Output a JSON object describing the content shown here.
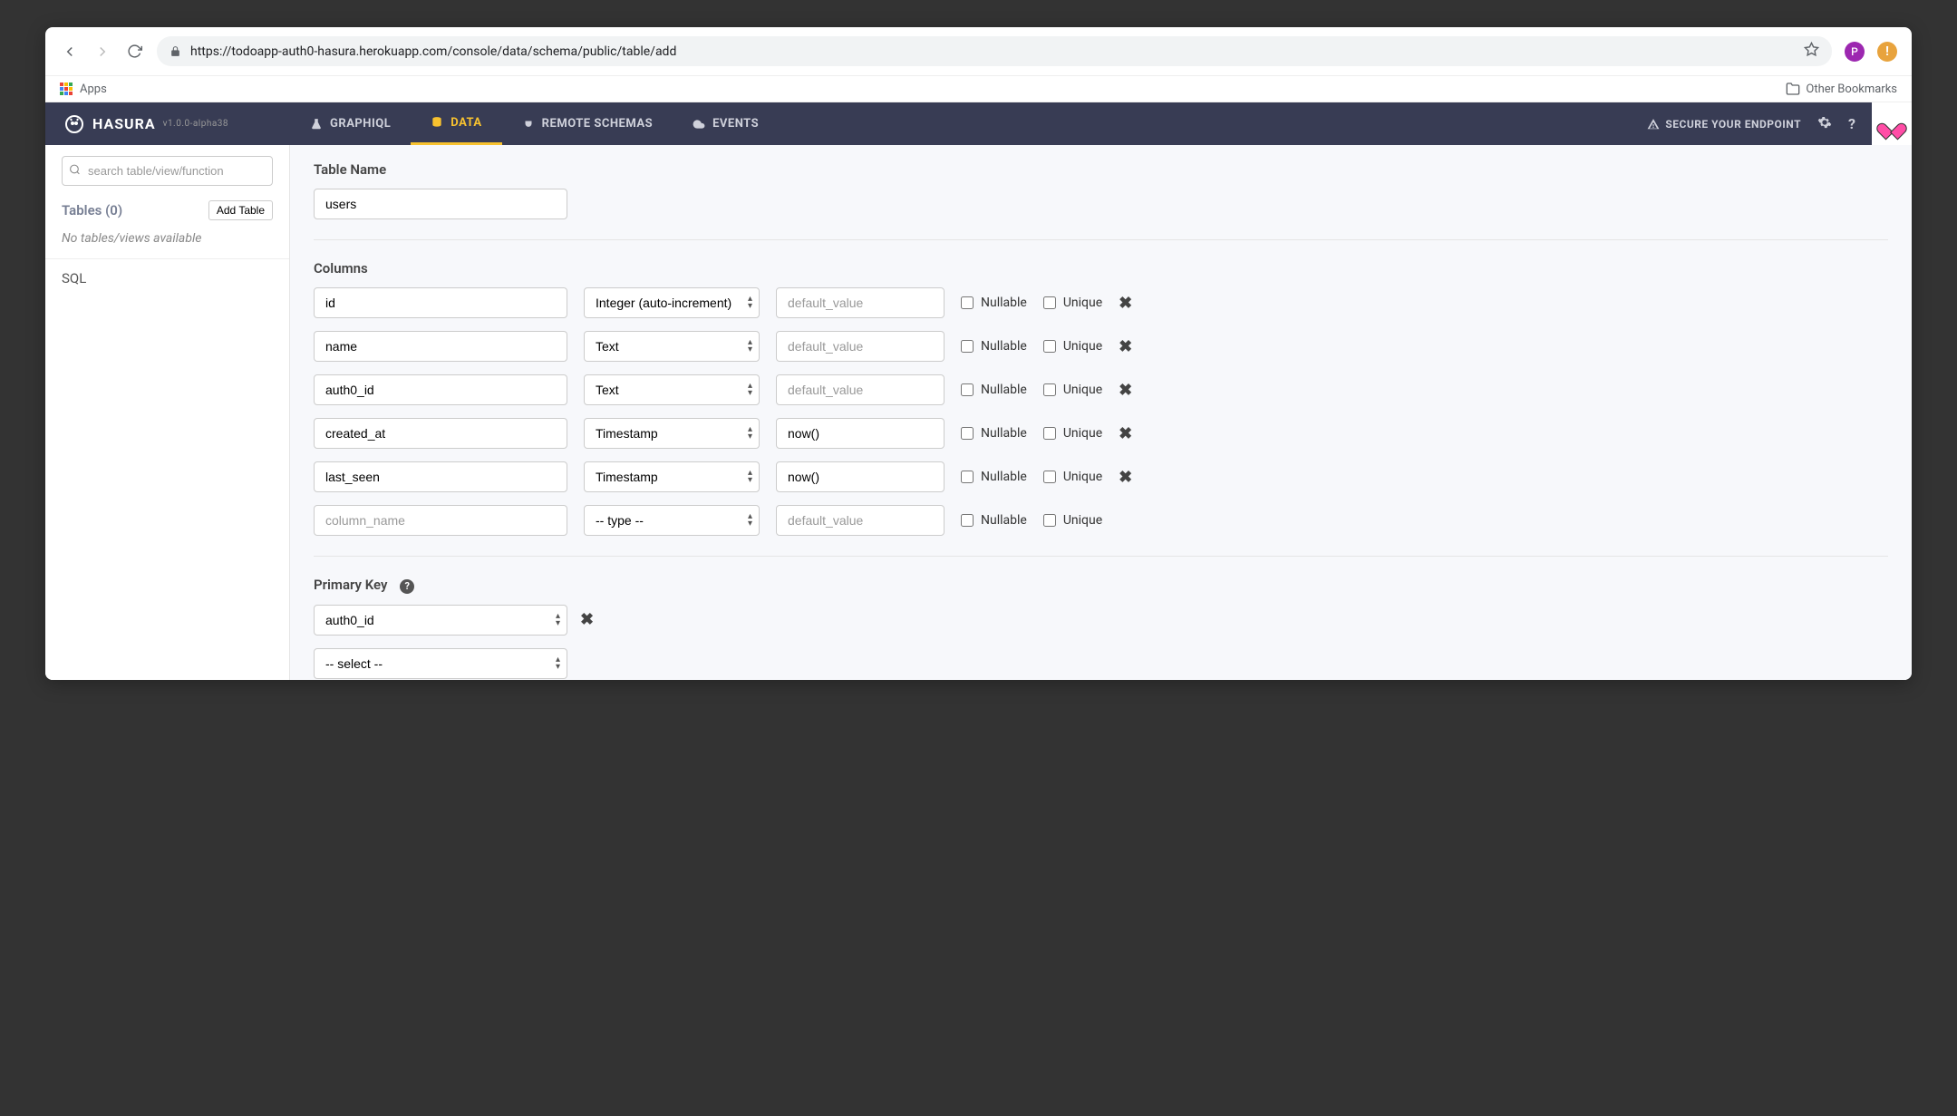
{
  "browser": {
    "url": "https://todoapp-auth0-hasura.herokuapp.com/console/data/schema/public/table/add",
    "apps_label": "Apps",
    "other_bookmarks": "Other Bookmarks"
  },
  "header": {
    "brand": "HASURA",
    "version": "v1.0.0-alpha38",
    "tabs": [
      {
        "label": "GRAPHIQL"
      },
      {
        "label": "DATA"
      },
      {
        "label": "REMOTE SCHEMAS"
      },
      {
        "label": "EVENTS"
      }
    ],
    "secure": "SECURE YOUR ENDPOINT"
  },
  "sidebar": {
    "search_placeholder": "search table/view/function",
    "tables_label": "Tables (0)",
    "add_table": "Add Table",
    "no_tables": "No tables/views available",
    "sql": "SQL"
  },
  "form": {
    "table_name_label": "Table Name",
    "table_name_value": "users",
    "columns_label": "Columns",
    "nullable_label": "Nullable",
    "unique_label": "Unique",
    "column_name_placeholder": "column_name",
    "type_placeholder": "-- type --",
    "default_placeholder": "default_value",
    "columns": [
      {
        "name": "id",
        "type": "Integer (auto-increment)",
        "default": ""
      },
      {
        "name": "name",
        "type": "Text",
        "default": ""
      },
      {
        "name": "auth0_id",
        "type": "Text",
        "default": ""
      },
      {
        "name": "created_at",
        "type": "Timestamp",
        "default": "now()"
      },
      {
        "name": "last_seen",
        "type": "Timestamp",
        "default": "now()"
      }
    ],
    "primary_key_label": "Primary Key",
    "pk_selected": "auth0_id",
    "pk_placeholder": "-- select --"
  }
}
